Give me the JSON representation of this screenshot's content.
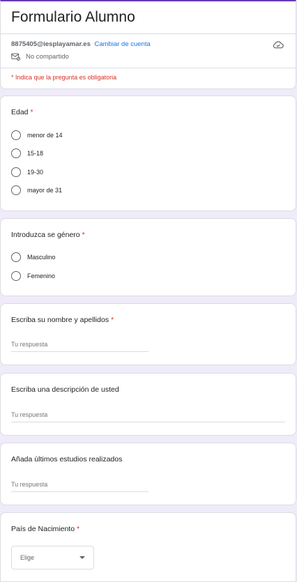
{
  "header": {
    "title": "Formulario Alumno",
    "email": "8875405@iesplayamar.es",
    "switch_account": "Cambiar de cuenta",
    "not_shared": "No compartido",
    "required_note": "* Indica que la pregunta es obligatoria"
  },
  "questions": {
    "edad": {
      "title": "Edad",
      "required": "*",
      "options": [
        "menor de 14",
        "15-18",
        "19-30",
        "mayor de 31"
      ]
    },
    "genero": {
      "title": "Introduzca se género",
      "required": "*",
      "options": [
        "Masculino",
        "Femenino"
      ]
    },
    "nombre": {
      "title": "Escriba su nombre y apellidos",
      "required": "*",
      "placeholder": "Tu respuesta"
    },
    "descripcion": {
      "title": "Escriba una descripción de usted",
      "placeholder": "Tu respuesta"
    },
    "estudios": {
      "title": "Añada últimos estudios realizados",
      "placeholder": "Tu respuesta"
    },
    "pais": {
      "title": "País de Nacimiento",
      "required": "*",
      "select_label": "Elige"
    }
  },
  "colors": {
    "accent": "#673ab7",
    "background": "#f0ebf8",
    "required": "#d93025",
    "link": "#1a73e8"
  },
  "icons": {
    "cloud": "cloud-save-icon",
    "share": "envelope-share-icon",
    "dropdown": "caret-down-icon"
  }
}
